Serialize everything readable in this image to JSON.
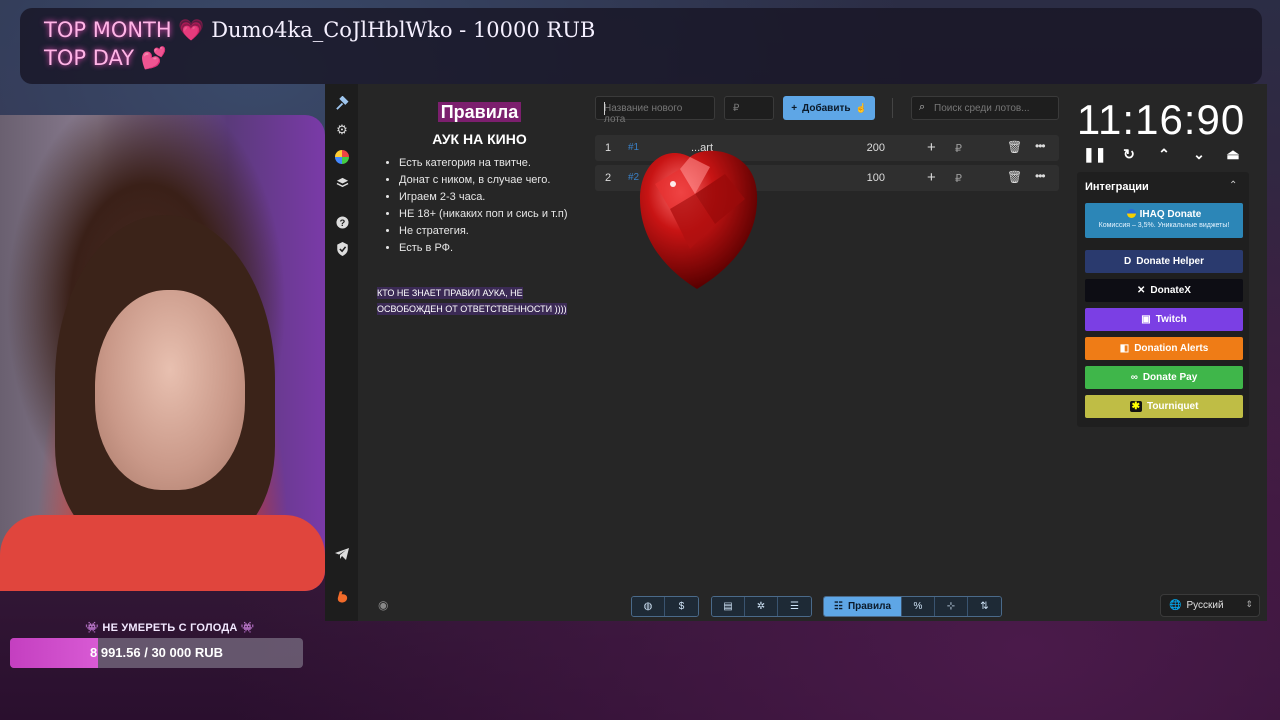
{
  "banner": {
    "top_month_label": "TOP MONTH",
    "top_month_value": "Dumo4ka_CoJlHblWko - 10000 RUB",
    "top_day_label": "TOP DAY"
  },
  "goal": {
    "title": "👾 НЕ УМЕРЕТЬ С ГОЛОДА 👾",
    "progress_text": "8 991.56 / 30 000 RUB",
    "current": 8991.56,
    "target": 30000
  },
  "rules": {
    "title": "Правила",
    "subtitle": "АУК НА КИНО",
    "items": [
      "Есть категория на твитче.",
      "Донат с ником, в случае чего.",
      "Играем 2-3 часа.",
      "НЕ 18+ (никаких поп и сись и т.п)",
      "Не стратегия.",
      "Есть в РФ."
    ],
    "note": "КТО НЕ ЗНАЕТ ПРАВИЛ АУКА, НЕ ОСВОБОЖДЕН ОТ ОТВЕТСТВЕННОСТИ ))))"
  },
  "toolbar": {
    "lot_name_placeholder": "Название нового лота",
    "amount_placeholder": "₽",
    "add_label": "Добавить",
    "search_placeholder": "Поиск среди лотов..."
  },
  "lots": [
    {
      "index": "1",
      "id": "#1",
      "name": "...art",
      "amount": "200",
      "currency": "₽"
    },
    {
      "index": "2",
      "id": "#2",
      "name": "",
      "amount": "100",
      "currency": "₽"
    }
  ],
  "timer": {
    "value": "11:16:90"
  },
  "integrations": {
    "title": "Интеграции",
    "ihaq": {
      "label": "IHAQ Donate",
      "sub": "Комиссия – 3,5%. Уникальные виджеты!"
    },
    "buttons": [
      {
        "label": "Donate Helper",
        "color": "#2a3a6e",
        "icon": "donate-helper-icon"
      },
      {
        "label": "DonateX",
        "color": "#0d0d14",
        "icon": "donatex-icon"
      },
      {
        "label": "Twitch",
        "color": "#7b3fe4",
        "icon": "twitch-icon"
      },
      {
        "label": "Donation Alerts",
        "color": "#ef7c16",
        "icon": "donation-alerts-icon"
      },
      {
        "label": "Donate Pay",
        "color": "#3fb64a",
        "icon": "donate-pay-icon"
      },
      {
        "label": "Tourniquet",
        "color": "#bfbd45",
        "icon": "tourniquet-icon"
      }
    ]
  },
  "bottom_bar": {
    "rules_label": "Правила",
    "language": "Русский"
  }
}
